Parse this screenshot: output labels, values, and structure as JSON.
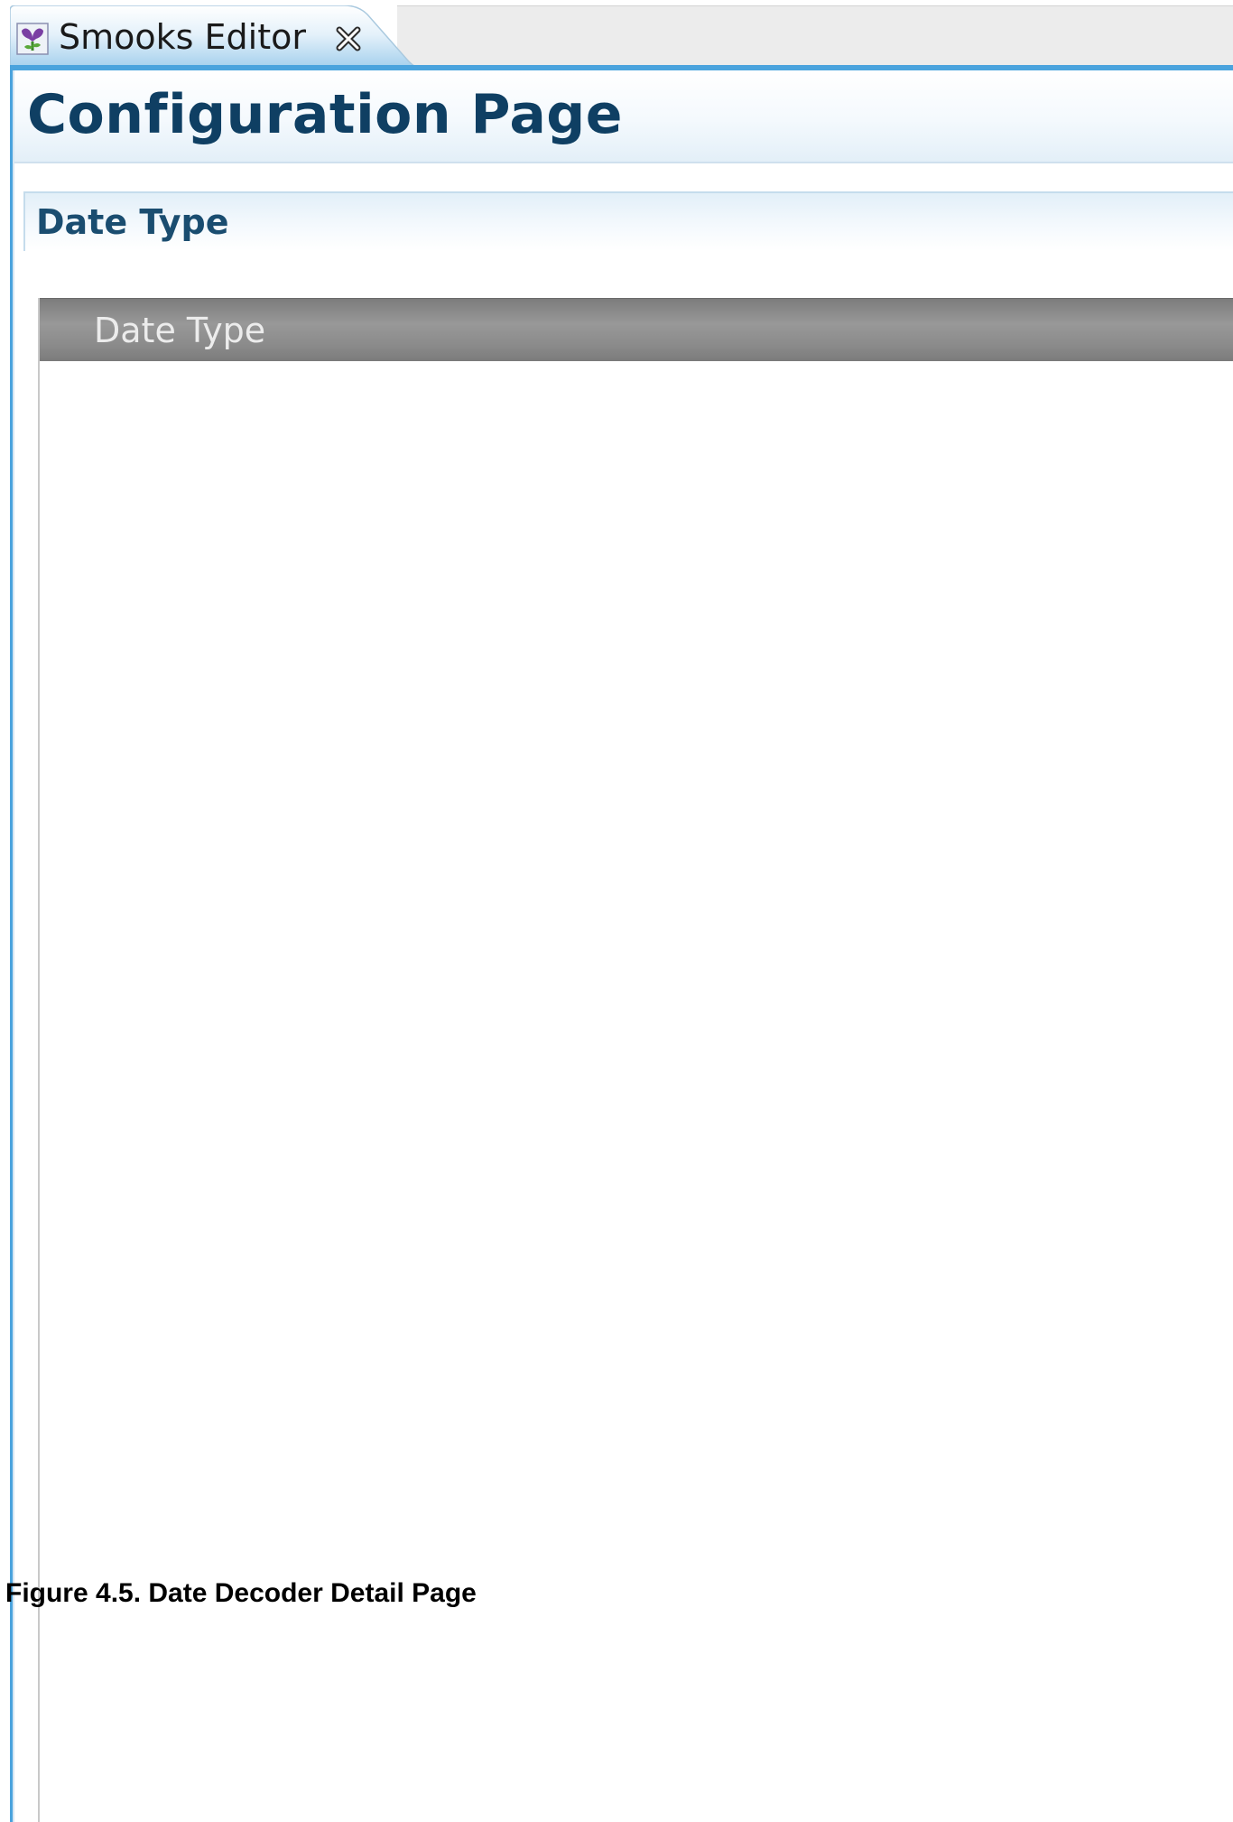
{
  "editor": {
    "tab": {
      "title": "Smooks Editor",
      "icon": "smooks-editor-icon",
      "close_icon": "close-icon"
    },
    "form": {
      "title": "Configuration Page"
    },
    "section": {
      "title": "Date Type",
      "table": {
        "columns": [
          "Date Type"
        ],
        "rows": []
      }
    }
  },
  "caption": "Figure 4.5. Date Decoder Detail Page",
  "colors": {
    "accent_blue": "#4aa3dd",
    "title_color": "#0f3f63",
    "section_title_color": "#1a4d70",
    "table_header_bg": "#8a8a8a"
  }
}
